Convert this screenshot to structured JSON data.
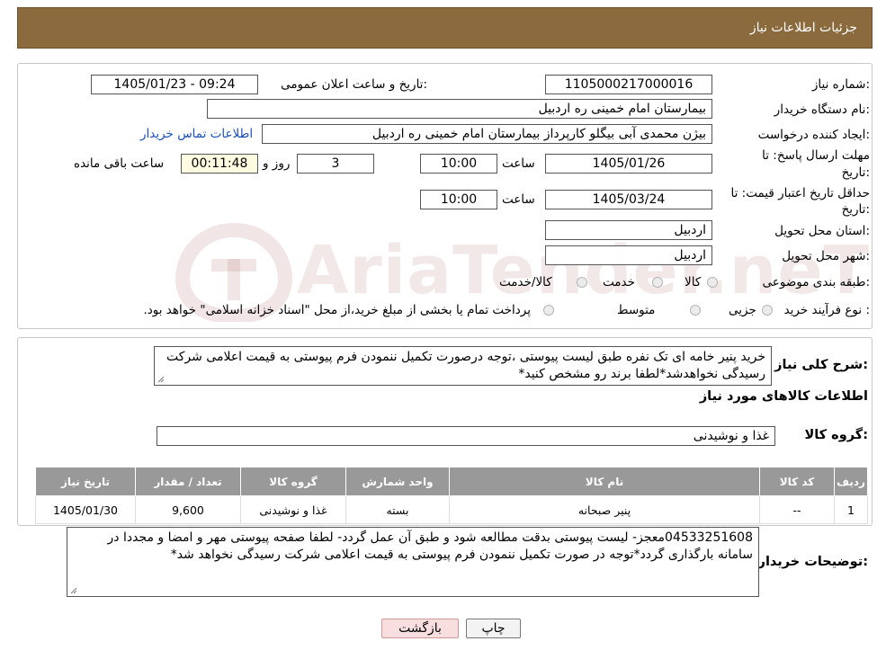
{
  "header": {
    "title": "جزئیات اطلاعات نیاز"
  },
  "form": {
    "need_number_label": "شماره نیاز:",
    "need_number": "1105000217000016",
    "announce_label": "تاریخ و ساعت اعلان عمومی:",
    "announce_value": "1405/01/23 - 09:24",
    "buyer_org_label": "نام دستگاه خریدار:",
    "buyer_org": "بیمارستان امام خمینی  ره  اردبیل",
    "requester_label": "ایجاد کننده درخواست:",
    "requester": "بیژن محمدی آبی بیگلو کارپرداز بیمارستان امام خمینی  ره  اردبیل",
    "contact_link": "اطلاعات تماس خریدار",
    "deadline_label_1": "مهلت ارسال پاسخ: تا",
    "deadline_label_2": "تاریخ:",
    "deadline_date": "1405/01/26",
    "time_label": "ساعت",
    "deadline_time": "10:00",
    "days_value": "3",
    "days_label": "روز و",
    "remaining_time": "00:11:48",
    "remaining_label": "ساعت باقی مانده",
    "validity_label_1": "حداقل تاریخ اعتبار قیمت: تا",
    "validity_label_2": "تاریخ:",
    "validity_date": "1405/03/24",
    "validity_time": "10:00",
    "province_label": "استان محل تحویل:",
    "province": "اردبیل",
    "city_label": "شهر محل تحویل:",
    "city": "اردبیل",
    "category_label": "طبقه بندی موضوعی:",
    "category_options": [
      "کالا",
      "خدمت",
      "کالا/خدمت"
    ],
    "process_label": "نوع فرآیند خرید :",
    "process_options": [
      "جزیی",
      "متوسط"
    ],
    "process_note": "پرداخت تمام یا بخشی از مبلغ خرید،از محل \"اسناد خزانه اسلامی\" خواهد بود."
  },
  "description": {
    "label": "شرح کلی نیاز:",
    "text": "خرید پنیر خامه ای تک نفره طبق لیست پیوستی ،توجه درصورت تکمیل ننمودن فرم پیوستی به قیمت اعلامی شرکت رسیدگی نخواهدشد*لطفا برند رو مشخص کنید*"
  },
  "goods": {
    "section_title": "اطلاعات کالاهای مورد نیاز",
    "group_label": "گروه کالا:",
    "group_value": "غذا و نوشیدنی",
    "table": {
      "headers": [
        "ردیف",
        "کد کالا",
        "نام کالا",
        "واحد شمارش",
        "گروه کالا",
        "تعداد / مقدار",
        "تاریخ نیاز"
      ],
      "rows": [
        [
          "1",
          "--",
          "پنیر صبحانه",
          "بسته",
          "غذا و نوشیدنی",
          "9,600",
          "1405/01/30"
        ]
      ]
    }
  },
  "buyer_notes": {
    "label": "توضیحات خریدار:",
    "text": "04533251608معجز- لیست پیوستی بدقت مطالعه شود و طبق آن عمل گردد- لطفا صفحه پیوستی مهر و امضا و مجددا در سامانه بارگذاری گردد*توجه در صورت تکمیل ننمودن فرم پیوستی به قیمت اعلامی شرکت رسیدگی نخواهد شد*"
  },
  "buttons": {
    "print": "چاپ",
    "back": "بازگشت"
  },
  "watermark": {
    "text": "AriaTender.neT"
  },
  "colors": {
    "header": "#8b6a3e",
    "table_header": "#999999",
    "link": "#1a4fb8",
    "back_button": "#f8dede"
  }
}
